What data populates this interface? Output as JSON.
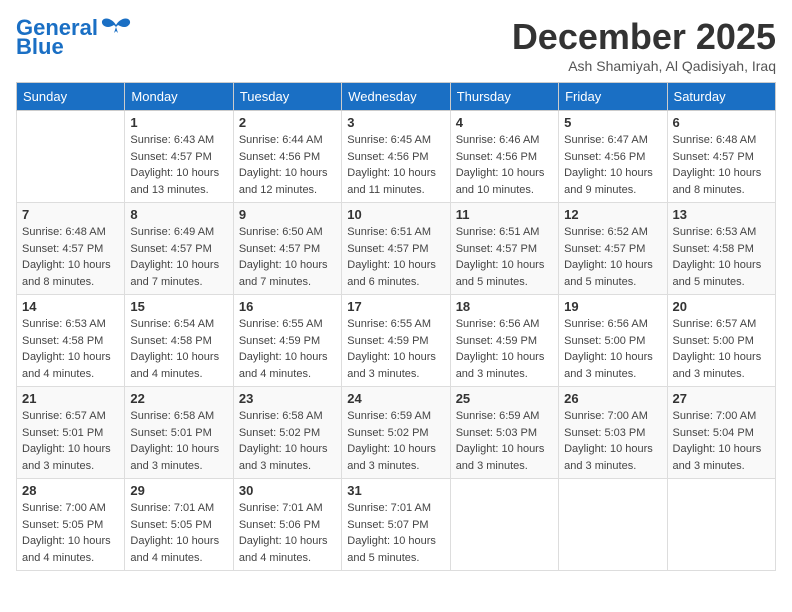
{
  "header": {
    "logo_line1": "General",
    "logo_line2": "Blue",
    "month": "December 2025",
    "location": "Ash Shamiyah, Al Qadisiyah, Iraq"
  },
  "weekdays": [
    "Sunday",
    "Monday",
    "Tuesday",
    "Wednesday",
    "Thursday",
    "Friday",
    "Saturday"
  ],
  "weeks": [
    [
      {
        "day": "",
        "text": ""
      },
      {
        "day": "1",
        "text": "Sunrise: 6:43 AM\nSunset: 4:57 PM\nDaylight: 10 hours\nand 13 minutes."
      },
      {
        "day": "2",
        "text": "Sunrise: 6:44 AM\nSunset: 4:56 PM\nDaylight: 10 hours\nand 12 minutes."
      },
      {
        "day": "3",
        "text": "Sunrise: 6:45 AM\nSunset: 4:56 PM\nDaylight: 10 hours\nand 11 minutes."
      },
      {
        "day": "4",
        "text": "Sunrise: 6:46 AM\nSunset: 4:56 PM\nDaylight: 10 hours\nand 10 minutes."
      },
      {
        "day": "5",
        "text": "Sunrise: 6:47 AM\nSunset: 4:56 PM\nDaylight: 10 hours\nand 9 minutes."
      },
      {
        "day": "6",
        "text": "Sunrise: 6:48 AM\nSunset: 4:57 PM\nDaylight: 10 hours\nand 8 minutes."
      }
    ],
    [
      {
        "day": "7",
        "text": "Sunrise: 6:48 AM\nSunset: 4:57 PM\nDaylight: 10 hours\nand 8 minutes."
      },
      {
        "day": "8",
        "text": "Sunrise: 6:49 AM\nSunset: 4:57 PM\nDaylight: 10 hours\nand 7 minutes."
      },
      {
        "day": "9",
        "text": "Sunrise: 6:50 AM\nSunset: 4:57 PM\nDaylight: 10 hours\nand 7 minutes."
      },
      {
        "day": "10",
        "text": "Sunrise: 6:51 AM\nSunset: 4:57 PM\nDaylight: 10 hours\nand 6 minutes."
      },
      {
        "day": "11",
        "text": "Sunrise: 6:51 AM\nSunset: 4:57 PM\nDaylight: 10 hours\nand 5 minutes."
      },
      {
        "day": "12",
        "text": "Sunrise: 6:52 AM\nSunset: 4:57 PM\nDaylight: 10 hours\nand 5 minutes."
      },
      {
        "day": "13",
        "text": "Sunrise: 6:53 AM\nSunset: 4:58 PM\nDaylight: 10 hours\nand 5 minutes."
      }
    ],
    [
      {
        "day": "14",
        "text": "Sunrise: 6:53 AM\nSunset: 4:58 PM\nDaylight: 10 hours\nand 4 minutes."
      },
      {
        "day": "15",
        "text": "Sunrise: 6:54 AM\nSunset: 4:58 PM\nDaylight: 10 hours\nand 4 minutes."
      },
      {
        "day": "16",
        "text": "Sunrise: 6:55 AM\nSunset: 4:59 PM\nDaylight: 10 hours\nand 4 minutes."
      },
      {
        "day": "17",
        "text": "Sunrise: 6:55 AM\nSunset: 4:59 PM\nDaylight: 10 hours\nand 3 minutes."
      },
      {
        "day": "18",
        "text": "Sunrise: 6:56 AM\nSunset: 4:59 PM\nDaylight: 10 hours\nand 3 minutes."
      },
      {
        "day": "19",
        "text": "Sunrise: 6:56 AM\nSunset: 5:00 PM\nDaylight: 10 hours\nand 3 minutes."
      },
      {
        "day": "20",
        "text": "Sunrise: 6:57 AM\nSunset: 5:00 PM\nDaylight: 10 hours\nand 3 minutes."
      }
    ],
    [
      {
        "day": "21",
        "text": "Sunrise: 6:57 AM\nSunset: 5:01 PM\nDaylight: 10 hours\nand 3 minutes."
      },
      {
        "day": "22",
        "text": "Sunrise: 6:58 AM\nSunset: 5:01 PM\nDaylight: 10 hours\nand 3 minutes."
      },
      {
        "day": "23",
        "text": "Sunrise: 6:58 AM\nSunset: 5:02 PM\nDaylight: 10 hours\nand 3 minutes."
      },
      {
        "day": "24",
        "text": "Sunrise: 6:59 AM\nSunset: 5:02 PM\nDaylight: 10 hours\nand 3 minutes."
      },
      {
        "day": "25",
        "text": "Sunrise: 6:59 AM\nSunset: 5:03 PM\nDaylight: 10 hours\nand 3 minutes."
      },
      {
        "day": "26",
        "text": "Sunrise: 7:00 AM\nSunset: 5:03 PM\nDaylight: 10 hours\nand 3 minutes."
      },
      {
        "day": "27",
        "text": "Sunrise: 7:00 AM\nSunset: 5:04 PM\nDaylight: 10 hours\nand 3 minutes."
      }
    ],
    [
      {
        "day": "28",
        "text": "Sunrise: 7:00 AM\nSunset: 5:05 PM\nDaylight: 10 hours\nand 4 minutes."
      },
      {
        "day": "29",
        "text": "Sunrise: 7:01 AM\nSunset: 5:05 PM\nDaylight: 10 hours\nand 4 minutes."
      },
      {
        "day": "30",
        "text": "Sunrise: 7:01 AM\nSunset: 5:06 PM\nDaylight: 10 hours\nand 4 minutes."
      },
      {
        "day": "31",
        "text": "Sunrise: 7:01 AM\nSunset: 5:07 PM\nDaylight: 10 hours\nand 5 minutes."
      },
      {
        "day": "",
        "text": ""
      },
      {
        "day": "",
        "text": ""
      },
      {
        "day": "",
        "text": ""
      }
    ]
  ]
}
